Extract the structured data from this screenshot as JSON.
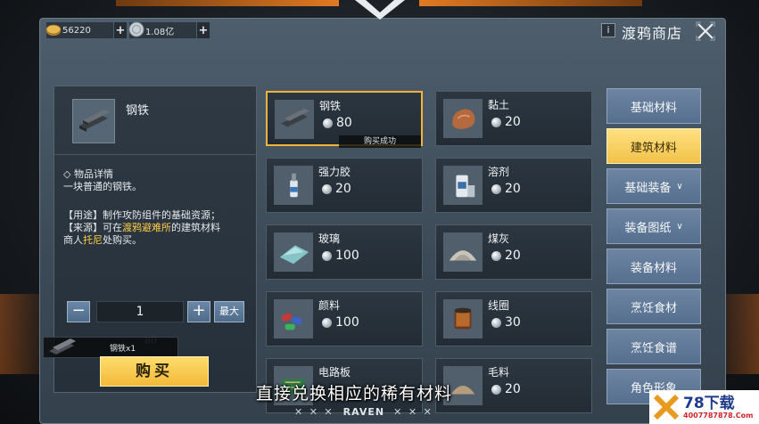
{
  "header": {
    "currency_gold": "56220",
    "currency_silver": "1.08亿",
    "plus_label": "+",
    "info_label": "i",
    "shop_title": "渡鸦商店"
  },
  "detail": {
    "name": "钢铁",
    "section_head": "◇ 物品详情",
    "description": "一块普通的钢铁。",
    "use_prefix": "【用途】制作攻防组件的基础资源；",
    "source_prefix": "【来源】可在",
    "source_place": "渡鸦避难所",
    "source_mid": "的建筑材料",
    "merchant_prefix": "商人",
    "merchant_name": "托尼",
    "merchant_suffix": "处购买。",
    "quantity": "1",
    "minus_label": "−",
    "plus_label": "+",
    "max_label": "最大",
    "cost_ghost": "80",
    "buy_label": "购买",
    "toast_text": "钢铁x1"
  },
  "items": [
    {
      "name": "钢铁",
      "price": "80",
      "status": "购买成功"
    },
    {
      "name": "黏土",
      "price": "20"
    },
    {
      "name": "强力胶",
      "price": "20"
    },
    {
      "name": "溶剂",
      "price": "20"
    },
    {
      "name": "玻璃",
      "price": "100"
    },
    {
      "name": "煤灰",
      "price": "20"
    },
    {
      "name": "颜料",
      "price": "100"
    },
    {
      "name": "线圈",
      "price": "30"
    },
    {
      "name": "电路板",
      "price": ""
    },
    {
      "name": "毛料",
      "price": "20"
    }
  ],
  "tabs": [
    {
      "label": "基础材料"
    },
    {
      "label": "建筑材料",
      "active": true
    },
    {
      "label": "基础装备",
      "chevron": "∨"
    },
    {
      "label": "装备图纸",
      "chevron": "∨"
    },
    {
      "label": "装备材料"
    },
    {
      "label": "烹饪食材"
    },
    {
      "label": "烹饪食谱"
    },
    {
      "label": "角色形象"
    }
  ],
  "subtitle": "直接兑换相应的稀有材料",
  "footer": {
    "marks_left": "✕ ✕ ✕",
    "brand": "RAVEN",
    "marks_right": "✕ ✕ ✕"
  },
  "watermark": {
    "main": "78下载",
    "sub": "4007787878.Com"
  },
  "colors": {
    "accent_gold": "#f2b93a",
    "tab_blue": "#6d85a3",
    "panel_bg": "#3c4a57"
  }
}
